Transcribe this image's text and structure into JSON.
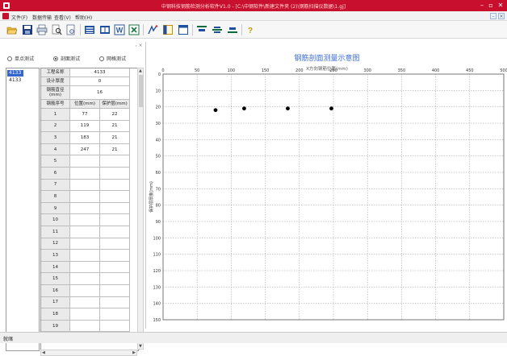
{
  "window": {
    "title": "中钢科技钢筋检测分析软件V1.0 - [C:\\中钢软件\\新建文件夹 (2)\\钢筋扫描仪数据\\1.gj]",
    "minimize": "–",
    "restore": "▫",
    "close": "✕"
  },
  "menu": {
    "items": [
      {
        "label": "文件(F)"
      },
      {
        "label": "数据传输"
      },
      {
        "label": "查看(V)"
      },
      {
        "label": "帮助(H)"
      }
    ],
    "mdi_minimize": "-",
    "mdi_close": "×"
  },
  "toolbar": {
    "buttons": [
      {
        "name": "open-folder-icon",
        "color": "#e9b431"
      },
      {
        "name": "save-icon",
        "color": "#1f3d7a"
      },
      {
        "name": "print-icon",
        "color": "#4a5a78"
      },
      {
        "name": "find-icon",
        "color": "#6b6b6b"
      },
      {
        "name": "print-preview-icon",
        "color": "#4a5a78"
      },
      {
        "name": "data-table-icon",
        "color": "#1e4fa1"
      },
      {
        "name": "database-icon",
        "color": "#1e4fa1"
      },
      {
        "name": "word-export-icon",
        "color": "#2b579a"
      },
      {
        "name": "excel-export-icon",
        "color": "#217346"
      },
      {
        "name": "measure-icon",
        "color": "#1e4fa1"
      },
      {
        "name": "panel-icon",
        "color": "#d18b00"
      },
      {
        "name": "window-icon",
        "color": "#1e4fa1"
      },
      {
        "name": "align-top-icon",
        "color": "#0e6a3c"
      },
      {
        "name": "align-middle-icon",
        "color": "#0e6a3c"
      },
      {
        "name": "align-bottom-icon",
        "color": "#0e6a3c"
      },
      {
        "name": "help-icon",
        "color": "#c49a00"
      }
    ]
  },
  "panel": {
    "ctl_label": "ᵣ ×"
  },
  "modes": {
    "items": [
      {
        "label": "单点测试",
        "selected": false
      },
      {
        "label": "剖面测试",
        "selected": true
      },
      {
        "label": "网格测试",
        "selected": false
      }
    ]
  },
  "tree": {
    "items": [
      {
        "label": "4133",
        "selected": true
      },
      {
        "label": "4133",
        "selected": false
      }
    ]
  },
  "info": {
    "project_label": "工程名称",
    "project_value": "4133",
    "depth_label": "设计厚度",
    "depth_value": "0",
    "diameter_label": "钢筋直径\n(mm)",
    "diameter_value": "16"
  },
  "table": {
    "columns": [
      "钢筋序号",
      "位置(mm)",
      "保护层(mm)"
    ],
    "rows": [
      {
        "n": "1",
        "pos": "77",
        "cover": "22"
      },
      {
        "n": "2",
        "pos": "119",
        "cover": "21"
      },
      {
        "n": "3",
        "pos": "183",
        "cover": "21"
      },
      {
        "n": "4",
        "pos": "247",
        "cover": "21"
      },
      {
        "n": "5",
        "pos": "",
        "cover": ""
      },
      {
        "n": "6",
        "pos": "",
        "cover": ""
      },
      {
        "n": "7",
        "pos": "",
        "cover": ""
      },
      {
        "n": "8",
        "pos": "",
        "cover": ""
      },
      {
        "n": "9",
        "pos": "",
        "cover": ""
      },
      {
        "n": "10",
        "pos": "",
        "cover": ""
      },
      {
        "n": "11",
        "pos": "",
        "cover": ""
      },
      {
        "n": "12",
        "pos": "",
        "cover": ""
      },
      {
        "n": "13",
        "pos": "",
        "cover": ""
      },
      {
        "n": "14",
        "pos": "",
        "cover": ""
      },
      {
        "n": "15",
        "pos": "",
        "cover": ""
      },
      {
        "n": "16",
        "pos": "",
        "cover": ""
      },
      {
        "n": "17",
        "pos": "",
        "cover": ""
      },
      {
        "n": "18",
        "pos": "",
        "cover": ""
      },
      {
        "n": "19",
        "pos": "",
        "cover": ""
      }
    ]
  },
  "chart_data": {
    "type": "scatter",
    "title": "钢筋剖面测量示意图",
    "xlabel": "X方向钢筋位置(mm)",
    "ylabel": "保护层厚度(mm)",
    "xlim": [
      0,
      500
    ],
    "ylim": [
      0,
      150
    ],
    "x_ticks": [
      0,
      50,
      100,
      150,
      200,
      250,
      300,
      350,
      400,
      450,
      500
    ],
    "y_ticks": [
      0,
      10,
      20,
      30,
      40,
      50,
      60,
      70,
      80,
      90,
      100,
      110,
      120,
      130,
      140,
      150
    ],
    "grid": true,
    "points": [
      {
        "x": 77,
        "y": 22
      },
      {
        "x": 119,
        "y": 21
      },
      {
        "x": 183,
        "y": 21
      },
      {
        "x": 247,
        "y": 21
      }
    ],
    "marker_color": "#000000",
    "title_color": "#3d6ed6"
  },
  "status": {
    "text": "就绪"
  }
}
